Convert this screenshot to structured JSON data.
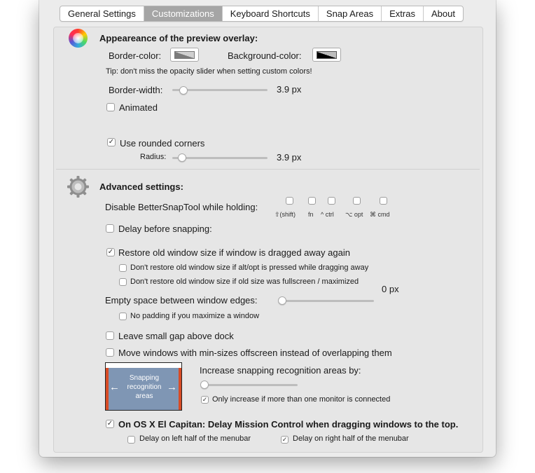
{
  "tabs": [
    {
      "label": "General Settings",
      "active": false
    },
    {
      "label": "Customizations",
      "active": true
    },
    {
      "label": "Keyboard Shortcuts",
      "active": false
    },
    {
      "label": "Snap Areas",
      "active": false
    },
    {
      "label": "Extras",
      "active": false
    },
    {
      "label": "About",
      "active": false
    }
  ],
  "appearance": {
    "heading": "Appeareance of the preview overlay:",
    "border_color_label": "Border-color:",
    "background_color_label": "Background-color:",
    "tip": "Tip: don't miss the opacity slider when setting custom colors!",
    "border_width_label": "Border-width:",
    "border_width_value": "3.9 px",
    "animated_label": "Animated",
    "animated_checked": false,
    "rounded_label": "Use rounded corners",
    "rounded_checked": true,
    "radius_label": "Radius:",
    "radius_value": "3.9 px"
  },
  "advanced": {
    "heading": "Advanced settings:",
    "disable_label": "Disable BetterSnapTool while holding:",
    "modifiers": [
      {
        "label": "⇧(shift)",
        "checked": false
      },
      {
        "label": "fn",
        "checked": false
      },
      {
        "label": "^ ctrl",
        "checked": false
      },
      {
        "label": "⌥ opt",
        "checked": false
      },
      {
        "label": "⌘ cmd",
        "checked": false
      }
    ],
    "delay_label": "Delay before snapping:",
    "delay_checked": false,
    "restore_label": "Restore old window size if window is dragged away again",
    "restore_checked": true,
    "restore_alt_label": "Don't restore old window size if alt/opt is pressed while dragging away",
    "restore_alt_checked": false,
    "restore_full_label": "Don't restore old window size if old size was fullscreen / maximized",
    "restore_full_checked": false,
    "space_label": "Empty space between window edges:",
    "space_value": "0 px",
    "no_padding_label": "No padding if you maximize a window",
    "no_padding_checked": false,
    "gap_label": "Leave small gap above dock",
    "gap_checked": false,
    "move_label": "Move windows with min-sizes offscreen instead of overlapping them",
    "move_checked": false,
    "snap_image_text": "Snapping recognition areas",
    "increase_label": "Increase snapping recognition areas by:",
    "monitor_label": "Only increase if more than one monitor is connected",
    "monitor_checked": true,
    "elcap_label": "On OS X El Capitan: Delay Mission Control when dragging windows to the top.",
    "elcap_checked": true,
    "delay_left_label": "Delay on left half of the menubar",
    "delay_left_checked": false,
    "delay_right_label": "Delay on right half of the menubar",
    "delay_right_checked": true
  },
  "colors": {
    "tab_active_bg": "#a5a5a5",
    "panel_bg": "#e6e6e6",
    "snap_blue": "#7f96b4",
    "snap_edge": "#d84b25"
  }
}
